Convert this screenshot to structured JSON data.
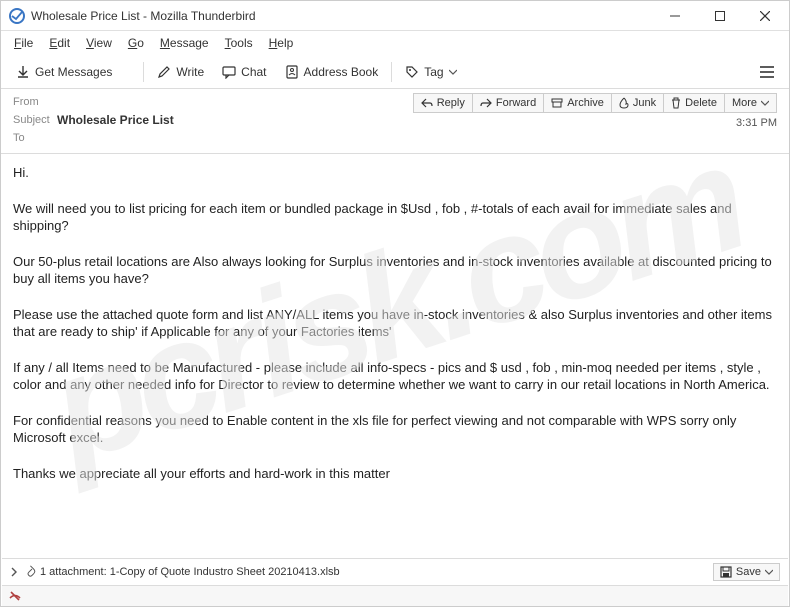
{
  "window": {
    "title": "Wholesale Price List - Mozilla Thunderbird"
  },
  "menus": {
    "file": "File",
    "edit": "Edit",
    "view": "View",
    "go": "Go",
    "message": "Message",
    "tools": "Tools",
    "help": "Help"
  },
  "toolbar": {
    "get": "Get Messages",
    "write": "Write",
    "chat": "Chat",
    "abook": "Address Book",
    "tag": "Tag"
  },
  "actions": {
    "reply": "Reply",
    "forward": "Forward",
    "archive": "Archive",
    "junk": "Junk",
    "delete": "Delete",
    "more": "More"
  },
  "headers": {
    "from_label": "From",
    "subject_label": "Subject",
    "to_label": "To",
    "subject": "Wholesale Price List",
    "time": "3:31 PM"
  },
  "body": {
    "p1": "Hi.",
    "p2": "We will need you to list pricing for each item or bundled package in $Usd , fob , #-totals of each avail for immediate sales and shipping?",
    "p3": "Our 50-plus retail locations are Also always looking for Surplus inventories and in-stock inventories available at discounted pricing to buy all items you have?",
    "p4": "Please use the attached quote form and list ANY/ALL items you have in-stock inventories & also Surplus inventories and  other items that are ready to ship' if Applicable for any of your Factories items'",
    "p5": "If any / all Items need to be Manufactured - please include all info-specs - pics and $ usd  , fob , min-moq needed per items , style , color and any other needed info for Director to review to determine whether we want to carry in our retail locations in North America.",
    "p6": "For confidential reasons you need to Enable content in the xls file for perfect viewing and not comparable with WPS sorry only Microsoft excel.",
    "p7": "Thanks  we appreciate all your efforts and hard-work in this matter"
  },
  "attach": {
    "summary": "1 attachment: 1-Copy of Quote Industro Sheet 20210413.xlsb",
    "save": "Save"
  },
  "watermark": "pcrisk.com"
}
